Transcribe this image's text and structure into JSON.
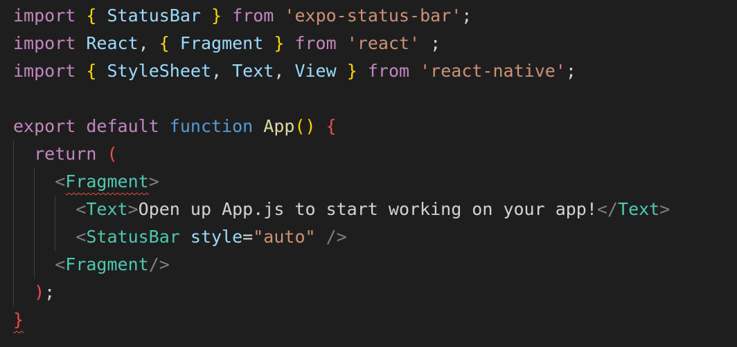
{
  "colors": {
    "background": "#1e1e1e",
    "keyword_control": "#c586c0",
    "variable": "#9cdcfe",
    "string": "#ce9178",
    "bracket_gold": "#ffd700",
    "bracket_orchid": "#da70d6",
    "bracket_blue": "#179fff",
    "bracket_red": "#f14c4c",
    "storage": "#569cd6",
    "function": "#dcdcaa",
    "tag": "#4ec9b0",
    "angle": "#808080",
    "plain": "#d4d4d4",
    "guide": "#404040",
    "error_squiggle": "#f14c4c"
  },
  "lines": [
    {
      "indent": 0,
      "guides": 0,
      "tokens": [
        {
          "text": "import",
          "color": "#c586c0"
        },
        {
          "text": " ",
          "color": "#d4d4d4"
        },
        {
          "text": "{",
          "color": "#ffd700"
        },
        {
          "text": " StatusBar ",
          "color": "#9cdcfe"
        },
        {
          "text": "}",
          "color": "#ffd700"
        },
        {
          "text": " ",
          "color": "#d4d4d4"
        },
        {
          "text": "from",
          "color": "#c586c0"
        },
        {
          "text": " ",
          "color": "#d4d4d4"
        },
        {
          "text": "'expo-status-bar'",
          "color": "#ce9178"
        },
        {
          "text": ";",
          "color": "#d4d4d4"
        }
      ]
    },
    {
      "indent": 0,
      "guides": 0,
      "tokens": [
        {
          "text": "import",
          "color": "#c586c0"
        },
        {
          "text": " ",
          "color": "#d4d4d4"
        },
        {
          "text": "React",
          "color": "#9cdcfe"
        },
        {
          "text": ", ",
          "color": "#d4d4d4"
        },
        {
          "text": "{",
          "color": "#ffd700"
        },
        {
          "text": " Fragment ",
          "color": "#9cdcfe"
        },
        {
          "text": "}",
          "color": "#ffd700"
        },
        {
          "text": " ",
          "color": "#d4d4d4"
        },
        {
          "text": "from",
          "color": "#c586c0"
        },
        {
          "text": " ",
          "color": "#d4d4d4"
        },
        {
          "text": "'react'",
          "color": "#ce9178"
        },
        {
          "text": " ;",
          "color": "#d4d4d4"
        }
      ]
    },
    {
      "indent": 0,
      "guides": 0,
      "tokens": [
        {
          "text": "import",
          "color": "#c586c0"
        },
        {
          "text": " ",
          "color": "#d4d4d4"
        },
        {
          "text": "{",
          "color": "#ffd700"
        },
        {
          "text": " StyleSheet",
          "color": "#9cdcfe"
        },
        {
          "text": ", ",
          "color": "#d4d4d4"
        },
        {
          "text": "Text",
          "color": "#9cdcfe"
        },
        {
          "text": ", ",
          "color": "#d4d4d4"
        },
        {
          "text": "View ",
          "color": "#9cdcfe"
        },
        {
          "text": "}",
          "color": "#ffd700"
        },
        {
          "text": " ",
          "color": "#d4d4d4"
        },
        {
          "text": "from",
          "color": "#c586c0"
        },
        {
          "text": " ",
          "color": "#d4d4d4"
        },
        {
          "text": "'react-native'",
          "color": "#ce9178"
        },
        {
          "text": ";",
          "color": "#d4d4d4"
        }
      ]
    },
    {
      "indent": 0,
      "guides": 0,
      "tokens": []
    },
    {
      "indent": 0,
      "guides": 0,
      "tokens": [
        {
          "text": "export",
          "color": "#c586c0"
        },
        {
          "text": " ",
          "color": "#d4d4d4"
        },
        {
          "text": "default",
          "color": "#c586c0"
        },
        {
          "text": " ",
          "color": "#d4d4d4"
        },
        {
          "text": "function",
          "color": "#569cd6"
        },
        {
          "text": " ",
          "color": "#d4d4d4"
        },
        {
          "text": "App",
          "color": "#dcdcaa"
        },
        {
          "text": "()",
          "color": "#ffd700"
        },
        {
          "text": " ",
          "color": "#d4d4d4"
        },
        {
          "text": "{",
          "color": "#f14c4c"
        }
      ]
    },
    {
      "indent": 1,
      "guides": 1,
      "tokens": [
        {
          "text": "return",
          "color": "#c586c0"
        },
        {
          "text": " ",
          "color": "#d4d4d4"
        },
        {
          "text": "(",
          "color": "#f14c4c"
        }
      ]
    },
    {
      "indent": 2,
      "guides": 2,
      "tokens": [
        {
          "text": "<",
          "color": "#808080"
        },
        {
          "text": "Fragment",
          "color": "#4ec9b0",
          "squiggle": true
        },
        {
          "text": ">",
          "color": "#808080"
        }
      ]
    },
    {
      "indent": 3,
      "guides": 3,
      "tokens": [
        {
          "text": "<",
          "color": "#808080"
        },
        {
          "text": "Text",
          "color": "#4ec9b0"
        },
        {
          "text": ">",
          "color": "#808080"
        },
        {
          "text": "Open up App.js to start working on your app!",
          "color": "#d4d4d4"
        },
        {
          "text": "</",
          "color": "#808080"
        },
        {
          "text": "Text",
          "color": "#4ec9b0"
        },
        {
          "text": ">",
          "color": "#808080"
        }
      ]
    },
    {
      "indent": 3,
      "guides": 3,
      "tokens": [
        {
          "text": "<",
          "color": "#808080"
        },
        {
          "text": "StatusBar",
          "color": "#4ec9b0"
        },
        {
          "text": " ",
          "color": "#d4d4d4"
        },
        {
          "text": "style",
          "color": "#9cdcfe"
        },
        {
          "text": "=",
          "color": "#d4d4d4"
        },
        {
          "text": "\"auto\"",
          "color": "#ce9178"
        },
        {
          "text": " ",
          "color": "#d4d4d4"
        },
        {
          "text": "/>",
          "color": "#808080"
        }
      ]
    },
    {
      "indent": 2,
      "guides": 2,
      "tokens": [
        {
          "text": "<",
          "color": "#808080"
        },
        {
          "text": "Fragment",
          "color": "#4ec9b0"
        },
        {
          "text": "/>",
          "color": "#808080"
        }
      ]
    },
    {
      "indent": 1,
      "guides": 1,
      "tokens": [
        {
          "text": ")",
          "color": "#f14c4c"
        },
        {
          "text": ";",
          "color": "#d4d4d4"
        }
      ]
    },
    {
      "indent": 0,
      "guides": 0,
      "tokens": [
        {
          "text": "}",
          "color": "#f14c4c",
          "squiggle": true
        }
      ]
    }
  ]
}
